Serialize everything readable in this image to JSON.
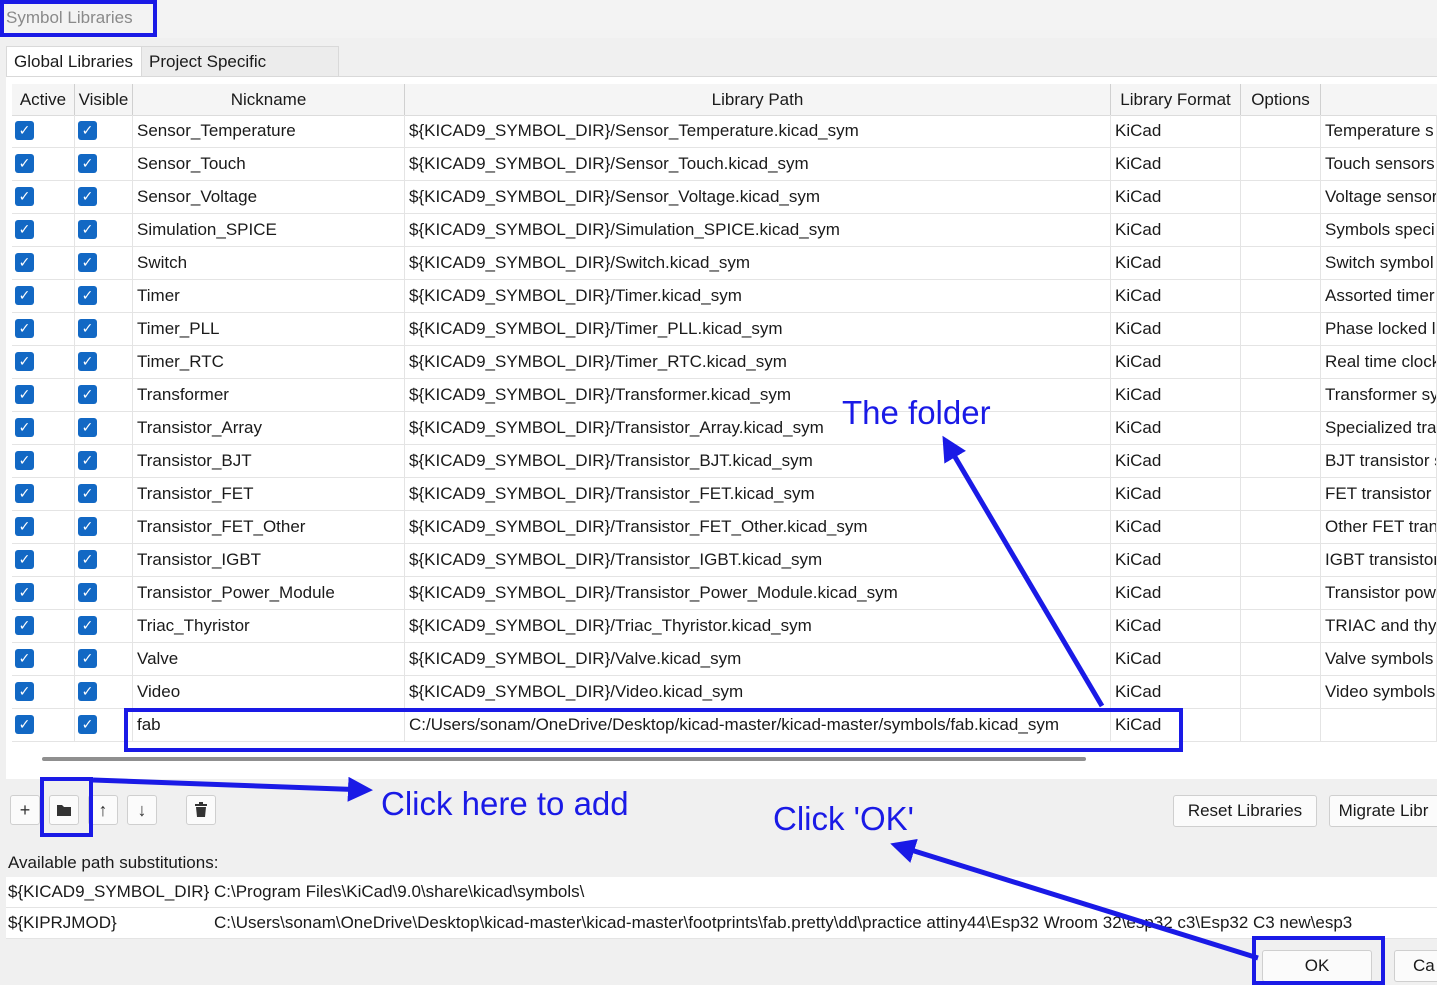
{
  "window": {
    "title": "Symbol Libraries"
  },
  "tabs": [
    {
      "label": "Global Libraries"
    },
    {
      "label": "Project Specific Libraries"
    }
  ],
  "columns": {
    "active": "Active",
    "visible": "Visible",
    "nickname": "Nickname",
    "path": "Library Path",
    "format": "Library Format",
    "options": "Options"
  },
  "rows": [
    {
      "nickname": "Sensor_Temperature",
      "path": "${KICAD9_SYMBOL_DIR}/Sensor_Temperature.kicad_sym",
      "format": "KiCad",
      "options": "",
      "description": "Temperature s"
    },
    {
      "nickname": "Sensor_Touch",
      "path": "${KICAD9_SYMBOL_DIR}/Sensor_Touch.kicad_sym",
      "format": "KiCad",
      "options": "",
      "description": "Touch sensors"
    },
    {
      "nickname": "Sensor_Voltage",
      "path": "${KICAD9_SYMBOL_DIR}/Sensor_Voltage.kicad_sym",
      "format": "KiCad",
      "options": "",
      "description": "Voltage sensor"
    },
    {
      "nickname": "Simulation_SPICE",
      "path": "${KICAD9_SYMBOL_DIR}/Simulation_SPICE.kicad_sym",
      "format": "KiCad",
      "options": "",
      "description": "Symbols speci"
    },
    {
      "nickname": "Switch",
      "path": "${KICAD9_SYMBOL_DIR}/Switch.kicad_sym",
      "format": "KiCad",
      "options": "",
      "description": "Switch symbol"
    },
    {
      "nickname": "Timer",
      "path": "${KICAD9_SYMBOL_DIR}/Timer.kicad_sym",
      "format": "KiCad",
      "options": "",
      "description": "Assorted timer"
    },
    {
      "nickname": "Timer_PLL",
      "path": "${KICAD9_SYMBOL_DIR}/Timer_PLL.kicad_sym",
      "format": "KiCad",
      "options": "",
      "description": "Phase locked l"
    },
    {
      "nickname": "Timer_RTC",
      "path": "${KICAD9_SYMBOL_DIR}/Timer_RTC.kicad_sym",
      "format": "KiCad",
      "options": "",
      "description": "Real time clock"
    },
    {
      "nickname": "Transformer",
      "path": "${KICAD9_SYMBOL_DIR}/Transformer.kicad_sym",
      "format": "KiCad",
      "options": "",
      "description": "Transformer sy"
    },
    {
      "nickname": "Transistor_Array",
      "path": "${KICAD9_SYMBOL_DIR}/Transistor_Array.kicad_sym",
      "format": "KiCad",
      "options": "",
      "description": "Specialized tra"
    },
    {
      "nickname": "Transistor_BJT",
      "path": "${KICAD9_SYMBOL_DIR}/Transistor_BJT.kicad_sym",
      "format": "KiCad",
      "options": "",
      "description": "BJT transistor s"
    },
    {
      "nickname": "Transistor_FET",
      "path": "${KICAD9_SYMBOL_DIR}/Transistor_FET.kicad_sym",
      "format": "KiCad",
      "options": "",
      "description": "FET transistor s"
    },
    {
      "nickname": "Transistor_FET_Other",
      "path": "${KICAD9_SYMBOL_DIR}/Transistor_FET_Other.kicad_sym",
      "format": "KiCad",
      "options": "",
      "description": "Other FET tran"
    },
    {
      "nickname": "Transistor_IGBT",
      "path": "${KICAD9_SYMBOL_DIR}/Transistor_IGBT.kicad_sym",
      "format": "KiCad",
      "options": "",
      "description": "IGBT transistor"
    },
    {
      "nickname": "Transistor_Power_Module",
      "path": "${KICAD9_SYMBOL_DIR}/Transistor_Power_Module.kicad_sym",
      "format": "KiCad",
      "options": "",
      "description": "Transistor pow"
    },
    {
      "nickname": "Triac_Thyristor",
      "path": "${KICAD9_SYMBOL_DIR}/Triac_Thyristor.kicad_sym",
      "format": "KiCad",
      "options": "",
      "description": "TRIAC and thy"
    },
    {
      "nickname": "Valve",
      "path": "${KICAD9_SYMBOL_DIR}/Valve.kicad_sym",
      "format": "KiCad",
      "options": "",
      "description": "Valve symbols"
    },
    {
      "nickname": "Video",
      "path": "${KICAD9_SYMBOL_DIR}/Video.kicad_sym",
      "format": "KiCad",
      "options": "",
      "description": "Video symbols"
    },
    {
      "nickname": "fab",
      "path": "C:/Users/sonam/OneDrive/Desktop/kicad-master/kicad-master/symbols/fab.kicad_sym",
      "format": "KiCad",
      "options": "",
      "description": ""
    }
  ],
  "toolbar": {
    "add_icon": "+",
    "folder_icon": "folder-icon",
    "up_icon": "↑",
    "down_icon": "↓",
    "delete_icon": "trash-icon",
    "reset_label": "Reset Libraries",
    "migrate_label": "Migrate Libr"
  },
  "substitutions": {
    "label": "Available path substitutions:",
    "items": [
      {
        "key": "${KICAD9_SYMBOL_DIR}",
        "value": "C:\\Program Files\\KiCad\\9.0\\share\\kicad\\symbols\\"
      },
      {
        "key": "${KIPRJMOD}",
        "value": "C:\\Users\\sonam\\OneDrive\\Desktop\\kicad-master\\kicad-master\\footprints\\fab.pretty\\dd\\practice attiny44\\Esp32 Wroom 32\\esp32 c3\\Esp32 C3 new\\esp3"
      }
    ]
  },
  "dialog_buttons": {
    "ok": "OK",
    "cancel": "Ca"
  },
  "annotations": {
    "folder_note": "The folder",
    "add_note": "Click here to add",
    "ok_note": "Click 'OK'",
    "color": "#1a1ae6"
  }
}
